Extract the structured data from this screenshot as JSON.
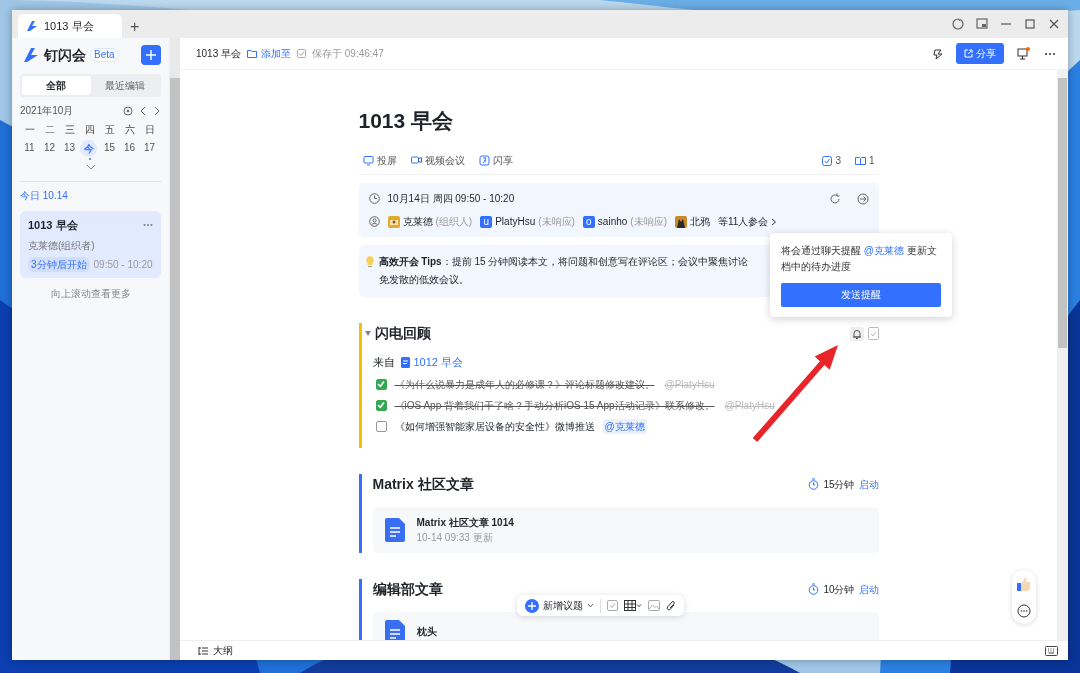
{
  "window": {
    "tabs": [
      {
        "label": "1013 早会",
        "selected": true
      }
    ],
    "new_tab": "+"
  },
  "sidebar": {
    "app_name": "钉闪会",
    "badge": "Beta",
    "filters": [
      {
        "label": "全部",
        "selected": true
      },
      {
        "label": "最近编辑",
        "selected": false
      }
    ],
    "calendar": {
      "month": "2021年10月",
      "weekdays": [
        "一",
        "二",
        "三",
        "四",
        "五",
        "六",
        "日"
      ],
      "days": [
        {
          "label": "11",
          "selected": false
        },
        {
          "label": "12",
          "selected": false
        },
        {
          "label": "13",
          "selected": false
        },
        {
          "label": "今",
          "selected": true
        },
        {
          "label": "15",
          "selected": false
        },
        {
          "label": "16",
          "selected": false
        },
        {
          "label": "17",
          "selected": false
        }
      ]
    },
    "section_label": "今日 10.14",
    "meetings": [
      {
        "title": "1013 早会",
        "organizer": "克莱德(组织者)",
        "status": "3分钟后开始",
        "time": "09:50 - 10:20",
        "selected": true
      }
    ],
    "more_hint": "向上滚动查看更多"
  },
  "header": {
    "breadcrumb": "1013 早会",
    "add_to": "添加至",
    "saved": "保存于 09:46:47",
    "share": "分享"
  },
  "document": {
    "title": "1013 早会",
    "actions": [
      "投屏",
      "视频会议",
      "闪享"
    ],
    "todo_count": "3",
    "doc_count": "1",
    "info": {
      "datetime": "10月14日 周四 09:50 - 10:20",
      "attendees": [
        {
          "name": "克莱德",
          "role": "(组织人)"
        },
        {
          "kind": "letter",
          "letter": "u",
          "name": "PlatyHsu",
          "role": "(未响应)"
        },
        {
          "kind": "letter",
          "letter": "o",
          "name": "sainho",
          "role": "(未响应)"
        },
        {
          "name": "北鸦"
        }
      ],
      "more": "等11人参会"
    },
    "tips": {
      "label": "高效开会 Tips",
      "separator": "：",
      "lines": [
        "提前 15 分钟阅读本文，将问题和创意写在评论区；会议中聚焦讨论",
        "免发散的低效会议。"
      ]
    },
    "sections": [
      {
        "kind": "todos",
        "title": "闪电回顾",
        "color": "#f2c200",
        "source_label": "来自",
        "source": "1012 早会",
        "todos": [
          {
            "text": "《为什么说暴力是成年人的必修课？》评论标题修改建议。",
            "mention": "@PlatyHsu",
            "checked": true
          },
          {
            "text": "《iOS App 背着我们干了啥？手动分析iOS 15 App活动记录》联系修改。",
            "mention": "@PlatyHsu",
            "checked": true
          },
          {
            "text": "《如何增强智能家居设备的安全性》微博推送",
            "mention": "@克莱德",
            "checked": false
          }
        ]
      },
      {
        "kind": "files",
        "title": "Matrix 社区文章",
        "color": "#3370ff",
        "duration": "15分钟",
        "start": "启动",
        "files": [
          {
            "name": "Matrix 社区文章 1014",
            "meta": "10-14 09:33 更新"
          }
        ]
      },
      {
        "kind": "files",
        "title": "编辑部文章",
        "color": "#3370ff",
        "duration": "10分钟",
        "start": "启动",
        "files": [
          {
            "name": "枕头"
          }
        ]
      }
    ]
  },
  "popover": {
    "before": "将会通过聊天提醒 ",
    "mention": "@克莱德",
    "after": " 更新文档中的待办进度",
    "button": "发送提醒"
  },
  "toolbar": {
    "new_topic": "新增议题"
  },
  "status_bar": {
    "outline": "大纲"
  }
}
